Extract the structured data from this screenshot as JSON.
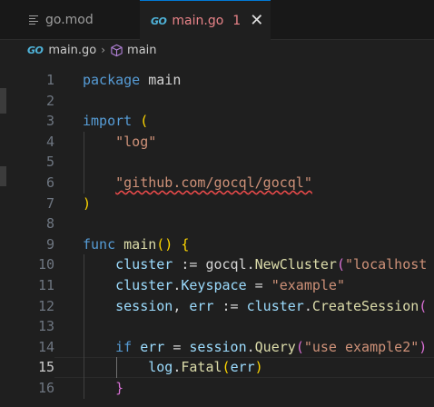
{
  "tabs": [
    {
      "label": "go.mod",
      "icon": "list-file-icon",
      "active": false
    },
    {
      "label": "main.go",
      "icon": "go-file-icon",
      "badge": "1",
      "active": true
    }
  ],
  "tab_icon_text": "GO",
  "breadcrumb": {
    "file": "main.go",
    "symbol": "main",
    "symbol_icon": "cube-icon"
  },
  "colors": {
    "keyword": "#569cd6",
    "function": "#dcdcaa",
    "string": "#ce9178",
    "variable": "#9cdcfe",
    "error": "#e88388"
  },
  "active_line": 15,
  "lines": [
    {
      "n": "1",
      "tokens": [
        [
          "kw",
          "package"
        ],
        [
          "pkg",
          " main"
        ]
      ]
    },
    {
      "n": "2",
      "tokens": []
    },
    {
      "n": "3",
      "tokens": [
        [
          "kw",
          "import"
        ],
        [
          "pkg",
          " "
        ],
        [
          "br1",
          "("
        ]
      ]
    },
    {
      "n": "4",
      "tokens": [
        [
          "pkg",
          "    "
        ],
        [
          "str",
          "\"log\""
        ]
      ]
    },
    {
      "n": "5",
      "tokens": []
    },
    {
      "n": "6",
      "tokens": [
        [
          "pkg",
          "    "
        ],
        [
          "str squiggle",
          "\"github.com/gocql/gocql\""
        ]
      ]
    },
    {
      "n": "7",
      "tokens": [
        [
          "br1",
          ")"
        ]
      ]
    },
    {
      "n": "8",
      "tokens": []
    },
    {
      "n": "9",
      "tokens": [
        [
          "kw",
          "func"
        ],
        [
          "pkg",
          " "
        ],
        [
          "fn",
          "main"
        ],
        [
          "br1",
          "()"
        ],
        [
          "pkg",
          " "
        ],
        [
          "br1",
          "{"
        ]
      ]
    },
    {
      "n": "10",
      "tokens": [
        [
          "pkg",
          "    "
        ],
        [
          "var",
          "cluster"
        ],
        [
          "pkg",
          " := gocql."
        ],
        [
          "fn",
          "NewCluster"
        ],
        [
          "br2",
          "("
        ],
        [
          "str",
          "\"localhost"
        ]
      ]
    },
    {
      "n": "11",
      "tokens": [
        [
          "pkg",
          "    "
        ],
        [
          "var",
          "cluster"
        ],
        [
          "pkg",
          "."
        ],
        [
          "var",
          "Keyspace"
        ],
        [
          "pkg",
          " = "
        ],
        [
          "str",
          "\"example\""
        ]
      ]
    },
    {
      "n": "12",
      "tokens": [
        [
          "pkg",
          "    "
        ],
        [
          "var",
          "session"
        ],
        [
          "pkg",
          ", "
        ],
        [
          "var",
          "err"
        ],
        [
          "pkg",
          " := "
        ],
        [
          "var",
          "cluster"
        ],
        [
          "pkg",
          "."
        ],
        [
          "fn",
          "CreateSession"
        ],
        [
          "br2",
          "("
        ]
      ]
    },
    {
      "n": "13",
      "tokens": []
    },
    {
      "n": "14",
      "tokens": [
        [
          "pkg",
          "    "
        ],
        [
          "kw",
          "if"
        ],
        [
          "pkg",
          " "
        ],
        [
          "var",
          "err"
        ],
        [
          "pkg",
          " = "
        ],
        [
          "var",
          "session"
        ],
        [
          "pkg",
          "."
        ],
        [
          "fn",
          "Query"
        ],
        [
          "br2",
          "("
        ],
        [
          "str",
          "\"use example2\""
        ],
        [
          "br2",
          ")"
        ]
      ]
    },
    {
      "n": "15",
      "tokens": [
        [
          "pkg",
          "        "
        ],
        [
          "var",
          "log"
        ],
        [
          "pkg",
          "."
        ],
        [
          "fn",
          "Fatal"
        ],
        [
          "br1",
          "("
        ],
        [
          "var",
          "err"
        ],
        [
          "br1",
          ")"
        ]
      ]
    },
    {
      "n": "16",
      "tokens": [
        [
          "pkg",
          "    "
        ],
        [
          "br2",
          "}"
        ]
      ]
    }
  ]
}
